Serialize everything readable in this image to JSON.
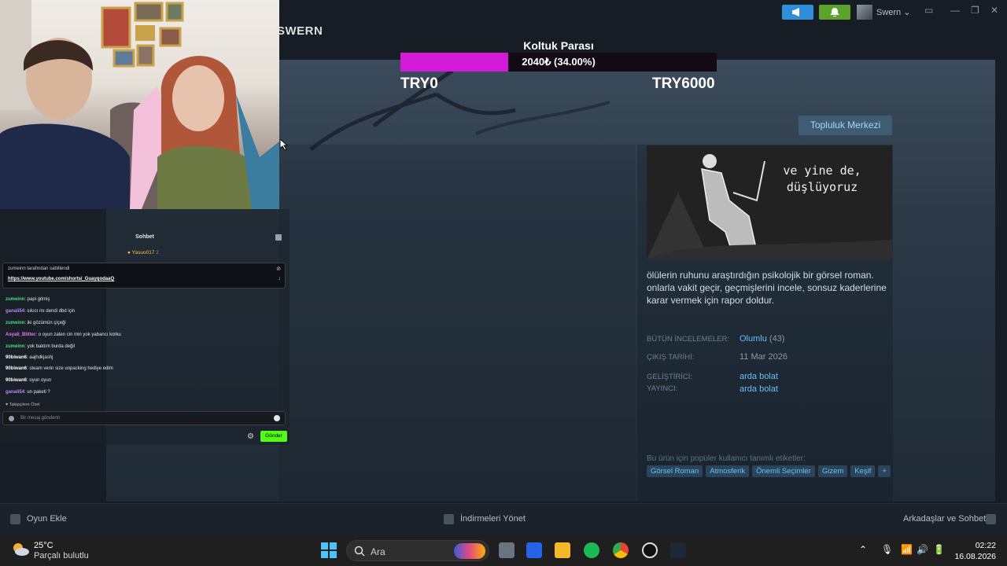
{
  "steam": {
    "brand": "SWERN",
    "username": "Swern",
    "community_button": "Topluluk Merkezi",
    "game": {
      "capsule_text": "ve yine de, düşlüyoruz",
      "description": "ölülerin ruhunu araştırdığın psikolojik bir görsel roman. onlarla vakit geçir, geçmişlerini incele, sonsuz kaderlerine karar vermek için rapor doldur.",
      "reviews_label": "BÜTÜN İNCELEMELER:",
      "reviews_value": "Olumlu",
      "reviews_count": "(43)",
      "release_label": "ÇIKIŞ TARİHİ:",
      "release_value": "11 Mar 2026",
      "developer_label": "GELİŞTİRİCİ:",
      "developer_value": "arda bolat",
      "publisher_label": "YAYINCI:",
      "publisher_value": "arda bolat",
      "tags_title": "Bu ürün için popüler kullanıcı tanımlı etiketler:",
      "tags": [
        "Görsel Roman",
        "Atmosferik",
        "Önemli Seçimler",
        "Gizem",
        "Keşif",
        "+"
      ]
    },
    "footer": {
      "add_game": "Oyun Ekle",
      "downloads": "İndirmeleri Yönet",
      "friends": "Arkadaşlar ve Sohbet"
    }
  },
  "goal": {
    "title": "Koltuk Parası",
    "progress_label": "2040₺ (34.00%)",
    "progress_fraction": 0.34,
    "min_label": "TRY0",
    "max_label": "TRY6000",
    "fill_color": "#d21ad8"
  },
  "chat": {
    "header": "Sohbet",
    "viewer": "Yasuo017",
    "viewer_count": "2",
    "pinned_by": "zumeinn tarafından sabitlendi",
    "pinned_link": "https://www.youtube.com/shorts/_GuayqodaaQ",
    "messages": [
      {
        "user": "zumeinn",
        "text": "papi gitmiş"
      },
      {
        "user": "ganali54",
        "text": "sıkıcı mı dendi dbd için"
      },
      {
        "user": "zumeinn",
        "text": "iki gözümün çiçeği"
      },
      {
        "user": "Asyali_Blitter",
        "text": "o oyun zaten cin min yok yabancı korku"
      },
      {
        "user": "zumeinn",
        "text": "yok baktım burda değil"
      },
      {
        "user": "90biwan6",
        "text": "aajhdkjashj"
      },
      {
        "user": "90biwan6",
        "text": "steam verin size unpacking hediye edim"
      },
      {
        "user": "90biwan6",
        "text": "oyun oyun"
      },
      {
        "user": "ganali54",
        "text": "un paketi ?"
      }
    ],
    "followers_only": "Takipçilere Özel",
    "input_placeholder": "Bir mesaj gönderin",
    "send_label": "Gönder"
  },
  "taskbar": {
    "temperature": "25°C",
    "weather": "Parçalı bulutlu",
    "search_placeholder": "Ara",
    "time": "02:22",
    "date": "16.08.2026"
  }
}
